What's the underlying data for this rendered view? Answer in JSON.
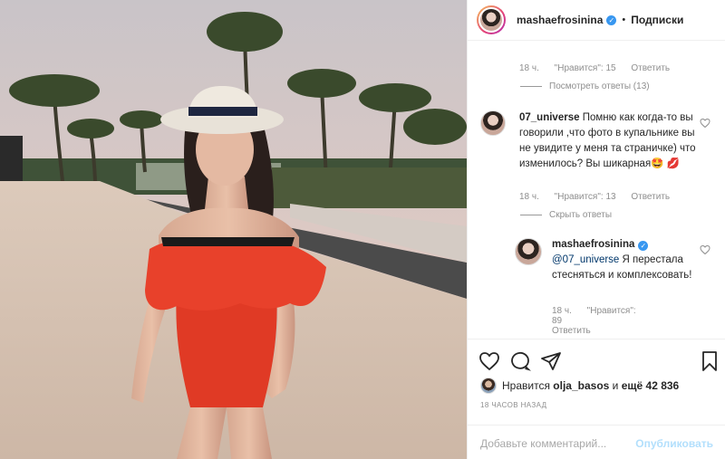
{
  "header": {
    "username": "mashaefrosinina",
    "verified_mark": "✓",
    "separator": "•",
    "follow_label": "Подписки"
  },
  "comments": {
    "first_meta": {
      "time": "18 ч.",
      "likes": "\"Нравится\": 15",
      "reply": "Ответить"
    },
    "view_replies": "Посмотреть ответы (13)",
    "comment1": {
      "username": "07_universe",
      "text": "Помню как когда-то вы говорили ,что фото в купальнике вы не увидите у меня та страничке) что изменилось? Вы шикарная🤩 💋"
    },
    "comment1_meta": {
      "time": "18 ч.",
      "likes": "\"Нравится\": 13",
      "reply": "Ответить"
    },
    "hide_replies": "Скрыть ответы",
    "reply1": {
      "username": "mashaefrosinina",
      "mention": "@07_universe",
      "text": " Я перестала стесняться и комплексовать!"
    },
    "reply1_meta": {
      "time": "18 ч.",
      "likes": "\"Нравится\": 89",
      "reply": "Ответить"
    }
  },
  "actions": {
    "icons": [
      "heart-icon",
      "comment-icon",
      "share-icon",
      "bookmark-icon"
    ],
    "likes_prefix": "Нравится",
    "likes_user": "olja_basos",
    "likes_and": "и",
    "likes_count": "ещё 42 836",
    "time_ago": "18 ЧАСОВ НАЗАД",
    "comment_placeholder": "Добавьте комментарий...",
    "publish_label": "Опубликовать"
  },
  "colors": {
    "link": "#00376b",
    "muted": "#8e8e8e",
    "verified": "#3897f0",
    "publish_disabled": "#b2dffc"
  }
}
